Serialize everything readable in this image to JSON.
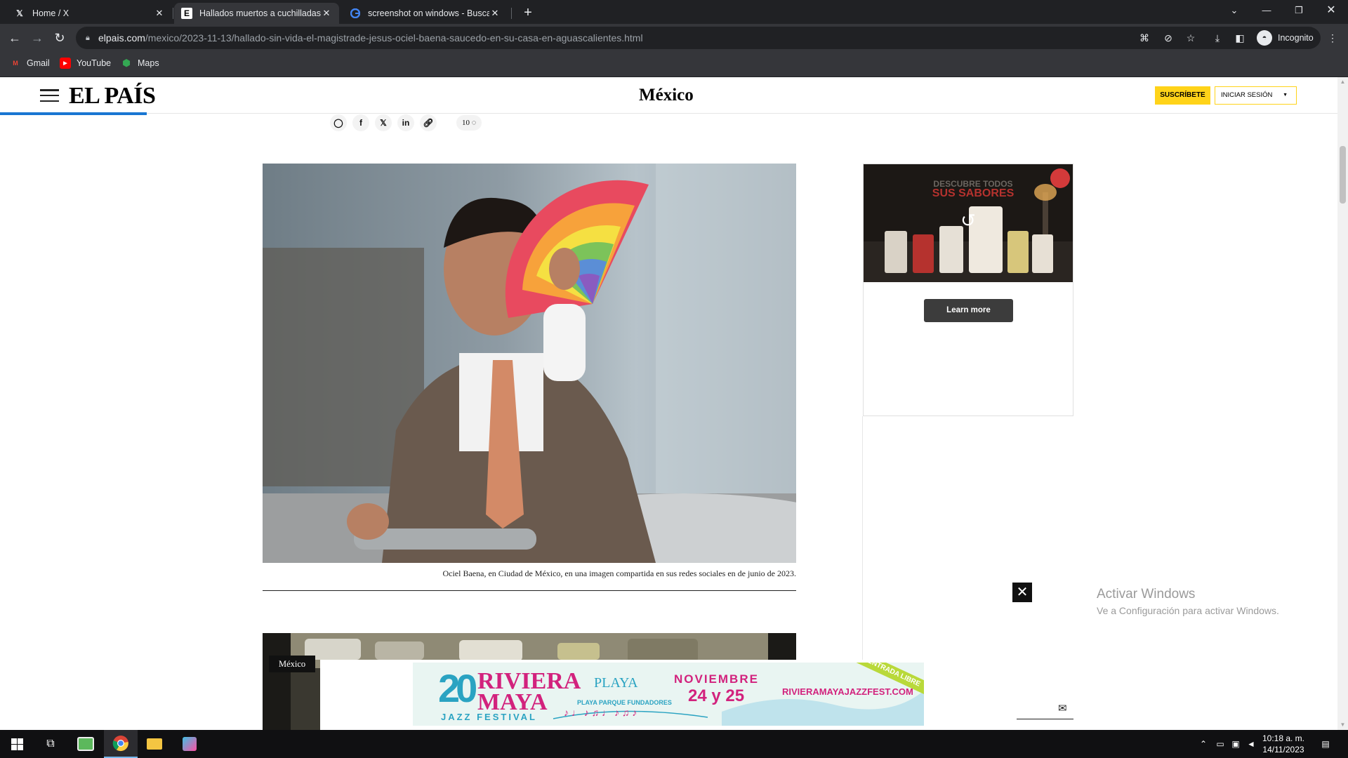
{
  "browser": {
    "tabs": [
      {
        "title": "Home / X",
        "icon": "x-logo-icon"
      },
      {
        "title": "Hallados muertos a cuchilladas e",
        "icon": "el-pais-icon"
      },
      {
        "title": "screenshot on windows - Buscar",
        "icon": "google-icon"
      }
    ],
    "active_tab": 1,
    "url_host": "elpais.com",
    "url_path": "/mexico/2023-11-13/hallado-sin-vida-el-magistrade-jesus-ociel-baena-saucedo-en-su-casa-en-aguascalientes.html",
    "profile_label": "Incognito",
    "bookmarks": [
      {
        "label": "Gmail",
        "icon": "gmail-icon"
      },
      {
        "label": "YouTube",
        "icon": "youtube-icon"
      },
      {
        "label": "Maps",
        "icon": "maps-icon"
      }
    ]
  },
  "site": {
    "logo": "EL PAÍS",
    "section": "México",
    "subscribe": "SUSCRÍBETE",
    "login": "INICIAR SESIÓN"
  },
  "article": {
    "comment_count": "10",
    "photo_caption": "Ociel Baena, en Ciudad de México, en una imagen compartida en sus redes sociales en de junio de 2023.",
    "second_photo_label": "México"
  },
  "side_ad": {
    "headline_1": "DESCUBRE TODOS",
    "headline_2": "SUS SABORES",
    "button": "Learn more"
  },
  "bottom_ad": {
    "number": "20",
    "title_1": "RIVIERA",
    "title_2": "MAYA",
    "subtitle": "JAZZ FESTIVAL",
    "venue": "PLAYA",
    "venue_sub": "PLAYA PARQUE FUNDADORES",
    "month": "NOVIEMBRE",
    "days": "24 y 25",
    "url": "RIVIERAMAYAJAZZFEST.COM",
    "ribbon": "ENTRADA LIBRE"
  },
  "watermark": {
    "line1": "Activar Windows",
    "line2": "Ve a Configuración para activar Windows."
  },
  "taskbar": {
    "time": "10:18 a. m.",
    "date": "14/11/2023"
  }
}
